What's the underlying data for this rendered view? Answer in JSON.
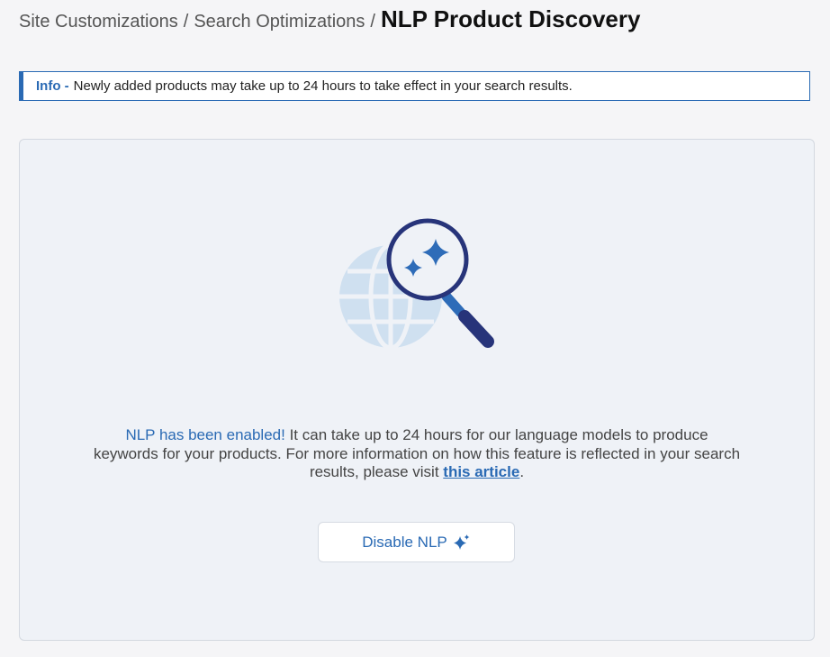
{
  "breadcrumb": {
    "items": [
      "Site Customizations",
      "Search Optimizations"
    ],
    "separator": "/",
    "current": "NLP Product Discovery"
  },
  "info_banner": {
    "label": "Info -",
    "text": "Newly added products may take up to 24 hours to take effect in your search results."
  },
  "status": {
    "highlight": "NLP has been enabled!",
    "body": " It can take up to 24 hours for our language models to produce keywords for your products. For more information on how this feature is reflected in your search results, please visit ",
    "link_text": "this article",
    "suffix": "."
  },
  "actions": {
    "disable_label": "Disable NLP",
    "disable_icon": "sparkle-icon"
  },
  "illustration": {
    "icons": [
      "globe-icon",
      "magnifier-icon",
      "sparkle-icon"
    ]
  },
  "colors": {
    "accent": "#2a6ab4",
    "card_background": "#eff2f7",
    "page_background": "#f5f5f7",
    "magnifier_frame": "#27347a",
    "globe": "#cfe0f0"
  }
}
